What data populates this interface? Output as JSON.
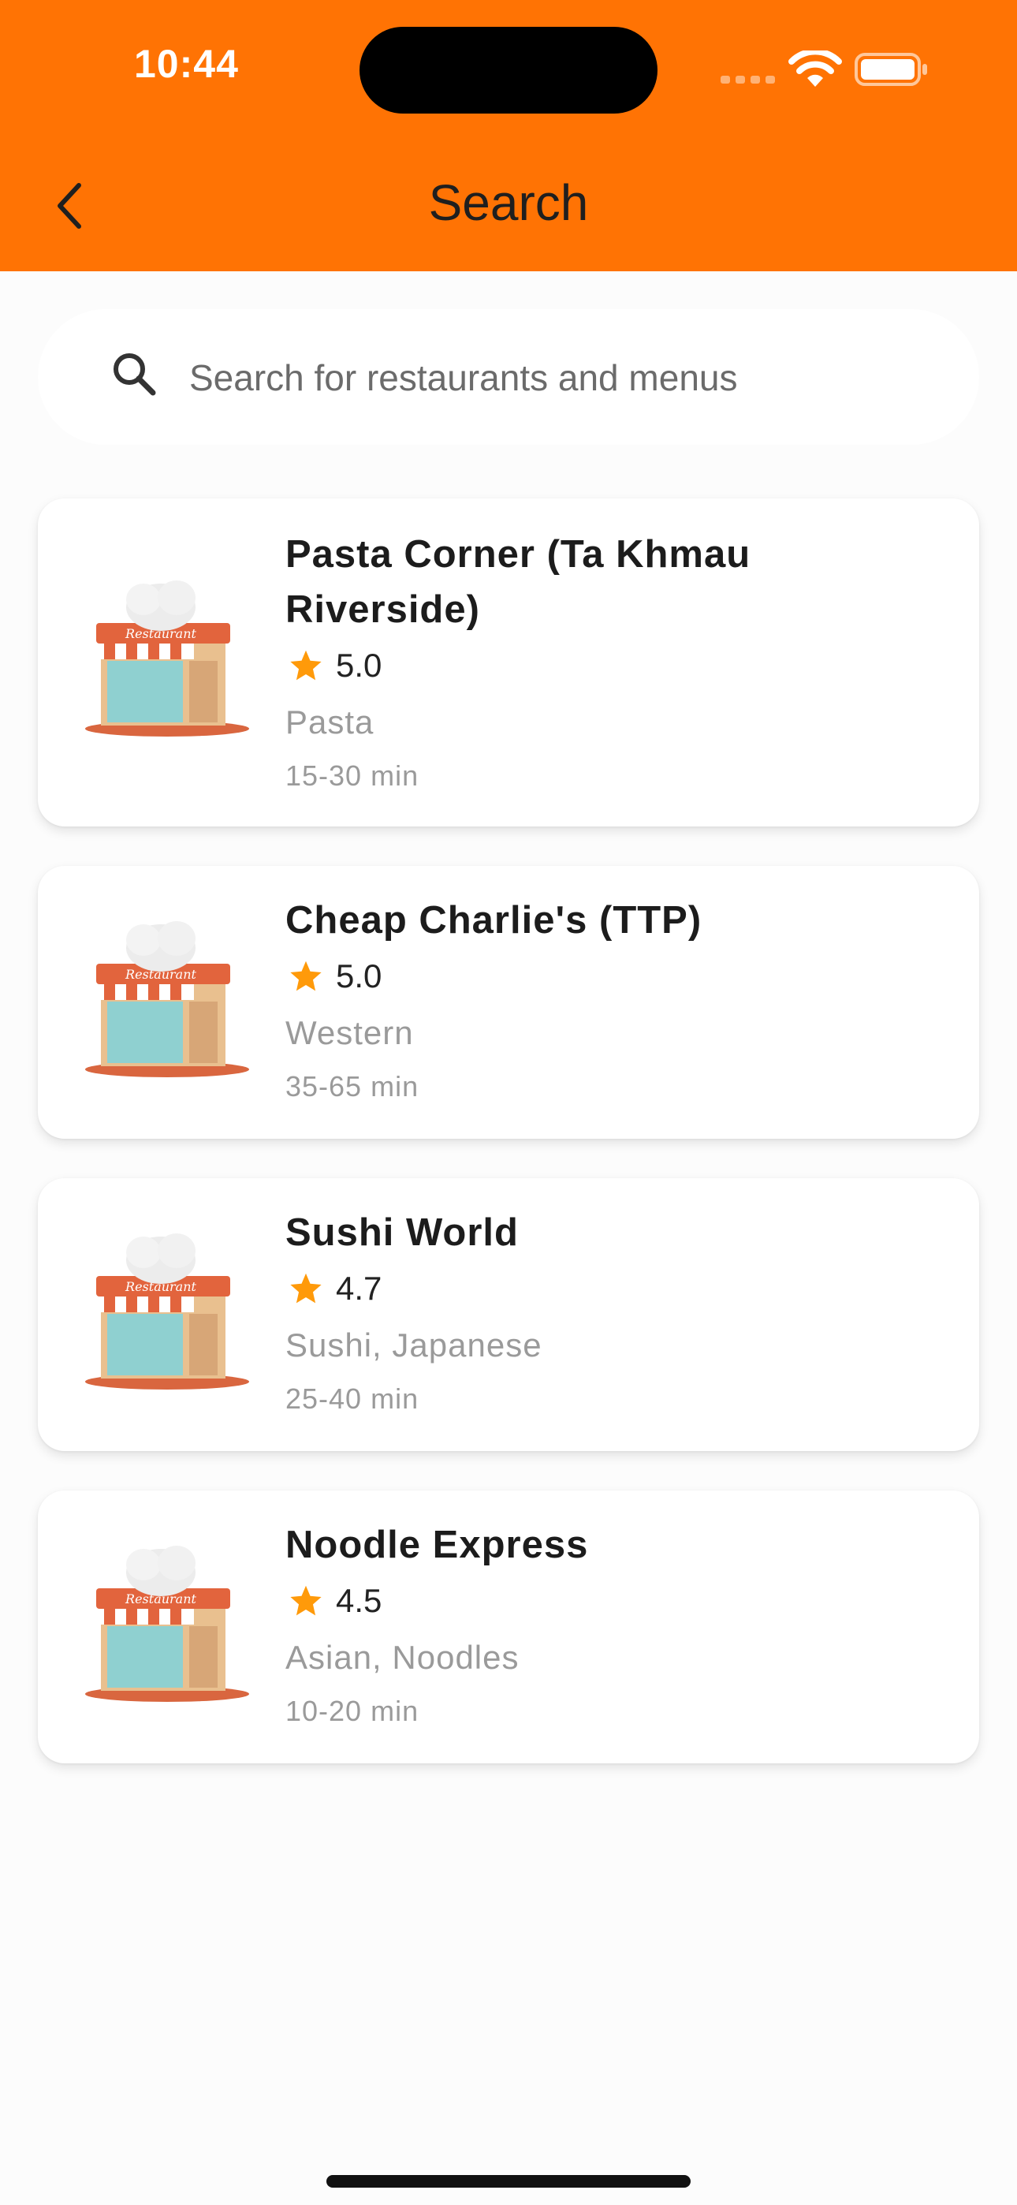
{
  "status_bar": {
    "time": "10:44"
  },
  "header": {
    "title": "Search",
    "back_icon": "chevron-left-icon"
  },
  "search": {
    "placeholder": "Search for restaurants and menus",
    "value": ""
  },
  "restaurants": [
    {
      "name": "Pasta Corner (Ta Khmau Riverside)",
      "rating": "5.0",
      "cuisine": "Pasta",
      "time": "15-30 min"
    },
    {
      "name": "Cheap Charlie's (TTP)",
      "rating": "5.0",
      "cuisine": "Western",
      "time": "35-65 min"
    },
    {
      "name": "Sushi World",
      "rating": "4.7",
      "cuisine": "Sushi, Japanese",
      "time": "25-40 min"
    },
    {
      "name": "Noodle Express",
      "rating": "4.5",
      "cuisine": "Asian, Noodles",
      "time": "10-20 min"
    }
  ],
  "thumbnail_sign": "Restaurant",
  "colors": {
    "accent": "#ff7304",
    "star": "#ff9a0a",
    "background": "#fcfcfc"
  }
}
